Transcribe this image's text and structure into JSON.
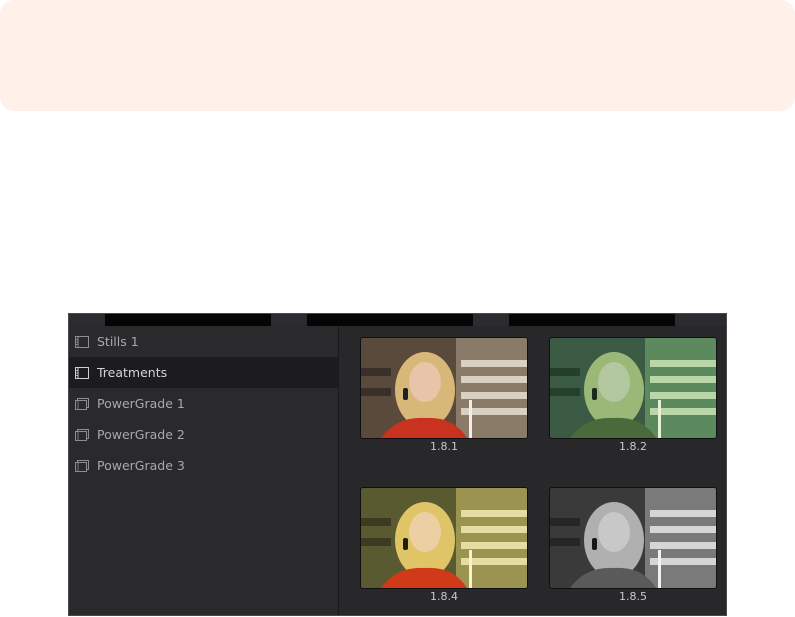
{
  "albums": [
    {
      "label": "Stills 1",
      "icon": "stills-album-icon",
      "selected": false
    },
    {
      "label": "Treatments",
      "icon": "stills-album-icon",
      "selected": true
    },
    {
      "label": "PowerGrade 1",
      "icon": "powergrade-album-icon",
      "selected": false
    },
    {
      "label": "PowerGrade 2",
      "icon": "powergrade-album-icon",
      "selected": false
    },
    {
      "label": "PowerGrade 3",
      "icon": "powergrade-album-icon",
      "selected": false
    }
  ],
  "stills": [
    {
      "label": "1.8.1",
      "grade": "original"
    },
    {
      "label": "1.8.2",
      "grade": "green-tint"
    },
    {
      "label": "1.8.4",
      "grade": "warm-yellow"
    },
    {
      "label": "1.8.5",
      "grade": "black-and-white"
    }
  ],
  "colors": {
    "panel_bg": "#28282b",
    "selected_row": "#1c1c1e",
    "text": "#a9a9ad"
  }
}
